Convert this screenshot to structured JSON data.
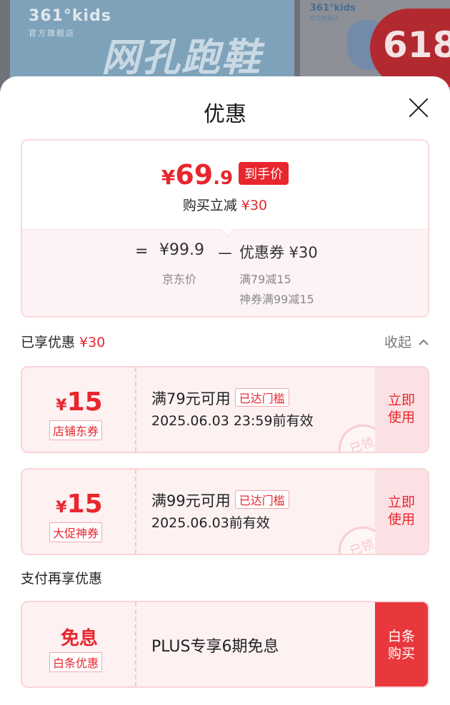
{
  "banner": {
    "logo": "361°kids",
    "logo_sub": "官方旗舰店",
    "slogan": "网孔跑鞋",
    "logo2": "361°kids",
    "logo2_sub": "官方旗舰店",
    "promo": "618"
  },
  "sheet": {
    "title": "优惠"
  },
  "summary": {
    "yen": "¥",
    "price_main": "69",
    "price_dec": ".9",
    "badge": "到手价",
    "save_label": "购买立减",
    "save_amount": "¥30",
    "eq": "=",
    "base_price": "¥99.9",
    "minus": "－",
    "coupon_total": "优惠券 ¥30",
    "base_label": "京东价",
    "detail_1": "满79减15",
    "detail_2": "神券满99减15"
  },
  "enjoyed": {
    "label": "已享优惠",
    "amount": "¥30",
    "collapse": "收起",
    "collapse_icon": "chevron-up-icon"
  },
  "coupons": [
    {
      "yen": "¥",
      "amount": "15",
      "tag": "店铺东券",
      "condition": "满79元可用",
      "met": "已达门槛",
      "validity": "2025.06.03 23:59前有效",
      "use_line1": "立即",
      "use_line2": "使用",
      "stamp": "已领"
    },
    {
      "yen": "¥",
      "amount": "15",
      "tag": "大促神券",
      "condition": "满99元可用",
      "met": "已达门槛",
      "validity": "2025.06.03前有效",
      "use_line1": "立即",
      "use_line2": "使用",
      "stamp": "已领"
    }
  ],
  "pay": {
    "label": "支付再享优惠",
    "main": "免息",
    "tag": "白条优惠",
    "text": "PLUS专享6期免息",
    "buy_line1": "白条",
    "buy_line2": "购买"
  },
  "colors": {
    "accent": "#e8262d",
    "card_bg": "#fdf1f2",
    "border": "#fad4d8"
  }
}
